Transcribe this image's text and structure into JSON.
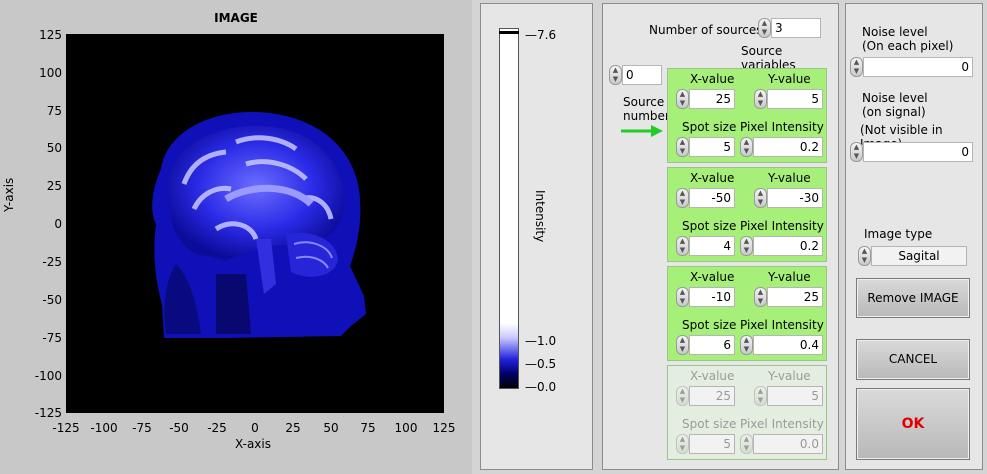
{
  "image_panel": {
    "title": "IMAGE",
    "y_axis_label": "Y-axis",
    "x_axis_label": "X-axis",
    "y_ticks": [
      "125",
      "100",
      "75",
      "50",
      "25",
      "0",
      "-25",
      "-50",
      "-75",
      "-100",
      "-125"
    ],
    "x_ticks": [
      "-125",
      "-100",
      "-75",
      "-50",
      "-25",
      "0",
      "25",
      "50",
      "75",
      "100",
      "125"
    ]
  },
  "colorbar": {
    "title": "Intensity",
    "labels": [
      "7.6",
      "1.0",
      "0.5",
      "0.0"
    ]
  },
  "sources": {
    "num_sources_label": "Number of sources:",
    "num_sources_value": "3",
    "source_variables_label": "Source variables",
    "source_number_value": "0",
    "source_number_label_1": "Source",
    "source_number_label_2": "number",
    "labels": {
      "x": "X-value",
      "y": "Y-value",
      "spot": "Spot size",
      "intensity": "Pixel Intensity"
    },
    "items": [
      {
        "x": "25",
        "y": "5",
        "spot": "5",
        "intensity": "0.2"
      },
      {
        "x": "-50",
        "y": "-30",
        "spot": "4",
        "intensity": "0.2"
      },
      {
        "x": "-10",
        "y": "25",
        "spot": "6",
        "intensity": "0.4"
      },
      {
        "x": "25",
        "y": "5",
        "spot": "5",
        "intensity": "0.0"
      }
    ]
  },
  "right": {
    "noise_pixel_label_1": "Noise level",
    "noise_pixel_label_2": "(On each pixel)",
    "noise_pixel_value": "0",
    "noise_signal_label_1": "Noise level",
    "noise_signal_label_2": "(on signal)",
    "noise_signal_label_3": "(Not visible in Image)",
    "noise_signal_value": "0",
    "image_type_label": "Image type",
    "image_type_value": "Sagital",
    "remove_label": "Remove IMAGE",
    "cancel_label": "CANCEL",
    "ok_label": "OK"
  },
  "colors": {
    "group_green": "#a6f07a",
    "ok_red": "#e00000",
    "arrow_green": "#22cc22"
  }
}
